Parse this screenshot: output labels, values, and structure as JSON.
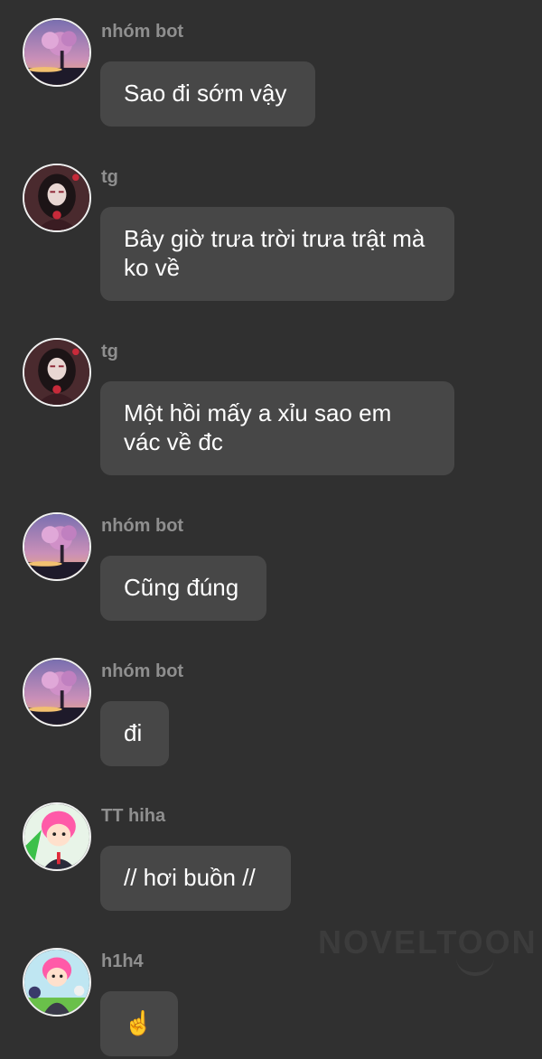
{
  "messages": [
    {
      "sender": "nhóm bot",
      "avatar_icon": "cherry-blossom-avatar-icon",
      "text": "Sao đi sớm vậy"
    },
    {
      "sender": "tg",
      "avatar_icon": "anime-girl-avatar-icon",
      "text": "Bây giờ trưa trời trưa trật mà ko về"
    },
    {
      "sender": "tg",
      "avatar_icon": "anime-girl-avatar-icon",
      "text": "Một hồi mấy a xỉu sao em vác về đc"
    },
    {
      "sender": "nhóm bot",
      "avatar_icon": "cherry-blossom-avatar-icon",
      "text": "Cũng đúng"
    },
    {
      "sender": "nhóm bot",
      "avatar_icon": "cherry-blossom-avatar-icon",
      "text": "đi"
    },
    {
      "sender": "TT hiha",
      "avatar_icon": "pink-hair-boy-avatar-icon",
      "text": "// hơi buồn //"
    },
    {
      "sender": "h1h4",
      "avatar_icon": "pink-hair-boy-suit-avatar-icon",
      "text": "☝️"
    }
  ],
  "watermark": "NOVELTOON"
}
